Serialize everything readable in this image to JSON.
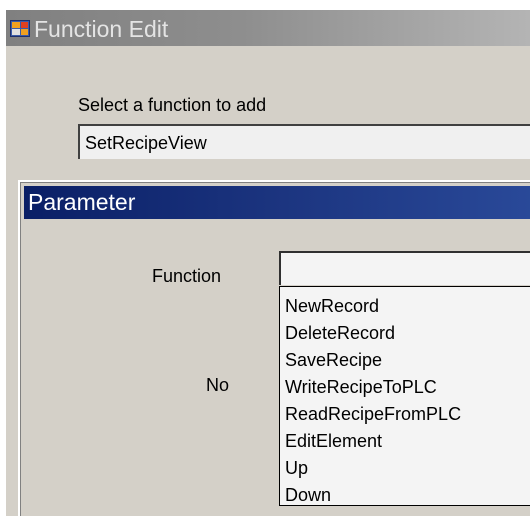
{
  "window": {
    "title": "Function Edit"
  },
  "function_select": {
    "label": "Select a function to add",
    "value": "SetRecipeView"
  },
  "parameter_group": {
    "title": "Parameter",
    "function_label": "Function",
    "function_value": "",
    "no_label": "No",
    "dropdown_options": [
      "NewRecord",
      "DeleteRecord",
      "SaveRecipe",
      "WriteRecipeToPLC",
      "ReadRecipeFromPLC",
      "EditElement",
      "Up",
      "Down"
    ]
  },
  "colors": {
    "window_background": "#d4d0c8",
    "group_header": "#0a1f66",
    "titlebar": "#8e8e8e"
  },
  "icons": {
    "app": "function-edit-app-icon"
  }
}
